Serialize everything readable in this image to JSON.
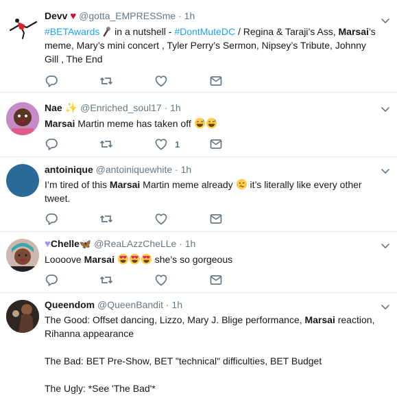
{
  "tweets": [
    {
      "name": "Devv",
      "handle": "@gotta_EMPRESSme",
      "time": "1h",
      "parts": {
        "hashtag1": "#BETAwards",
        "text1": " in a nutshell - ",
        "hashtag2": "#DontMuteDC",
        "text2": " / Regina & Taraji’s Ass, ",
        "bold": "Marsai",
        "text3": "’s meme, Mary’s mini concert , Tyler Perry’s Sermon, Nipsey’s Tribute, Johnny Gill , The End"
      }
    },
    {
      "name": "Nae",
      "handle": "@Enriched_soul17",
      "time": "1h",
      "parts": {
        "bold": "Marsai",
        "text1": " Martin meme has taken off "
      },
      "like_count": "1"
    },
    {
      "name": "antoinique",
      "handle": "@antoiniquewhite",
      "time": "1h",
      "parts": {
        "text1": "I’m tired of this ",
        "bold": "Marsai",
        "text2": " Martin meme already ",
        "text3": " it’s literally like every other tweet."
      }
    },
    {
      "name": "Chelle",
      "handle": "@ReaLAzzCheLLe",
      "time": "1h",
      "parts": {
        "text1": "Loooove ",
        "bold": "Marsai",
        "text2": " she’s so gorgeous"
      }
    },
    {
      "name": "Queendom",
      "handle": "@QueenBandit",
      "time": "1h",
      "parts": {
        "good1": "The Good: Offset dancing, Lizzo, Mary J. Blige performance, ",
        "bold": "Marsai",
        "good2": " reaction, Rihanna appearance",
        "bad": "The Bad: BET Pre-Show, BET \"technical\" difficulties, BET Budget",
        "ugly": "The Ugly: *See 'The Bad'*"
      }
    }
  ],
  "icons": {
    "reply": "reply-icon",
    "retweet": "retweet-icon",
    "like": "heart-icon",
    "dm": "envelope-icon",
    "menu": "chevron-down-icon"
  },
  "colors": {
    "link": "#1da1f2",
    "secondary": "#657786",
    "divider": "#e6ecf0"
  }
}
